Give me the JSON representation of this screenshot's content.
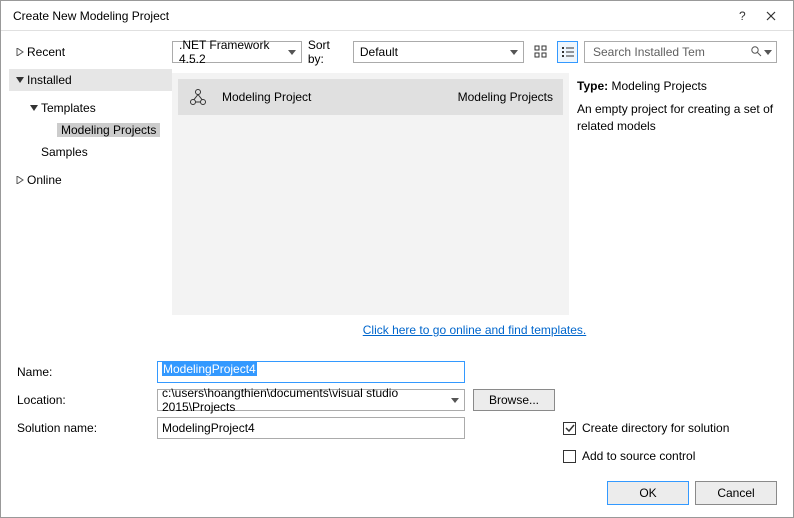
{
  "title": "Create New Modeling Project",
  "tree": {
    "recent": "Recent",
    "installed": "Installed",
    "templates": "Templates",
    "modeling_projects": "Modeling Projects",
    "samples": "Samples",
    "online": "Online"
  },
  "filters": {
    "framework": ".NET Framework 4.5.2",
    "sort_label": "Sort by:",
    "sort_value": "Default",
    "search_placeholder": "Search Installed Tem"
  },
  "template": {
    "name": "Modeling Project",
    "category": "Modeling Projects"
  },
  "details": {
    "type_label": "Type:",
    "type_value": "Modeling Projects",
    "description": "An empty project for creating a set of related models"
  },
  "online_link": "Click here to go online and find templates.",
  "form": {
    "name_label": "Name:",
    "name_value": "ModelingProject4",
    "location_label": "Location:",
    "location_value": "c:\\users\\hoangthien\\documents\\visual studio 2015\\Projects",
    "solution_label": "Solution name:",
    "solution_value": "ModelingProject4",
    "browse": "Browse...",
    "create_dir": "Create directory for solution",
    "add_source": "Add to source control"
  },
  "buttons": {
    "ok": "OK",
    "cancel": "Cancel"
  }
}
